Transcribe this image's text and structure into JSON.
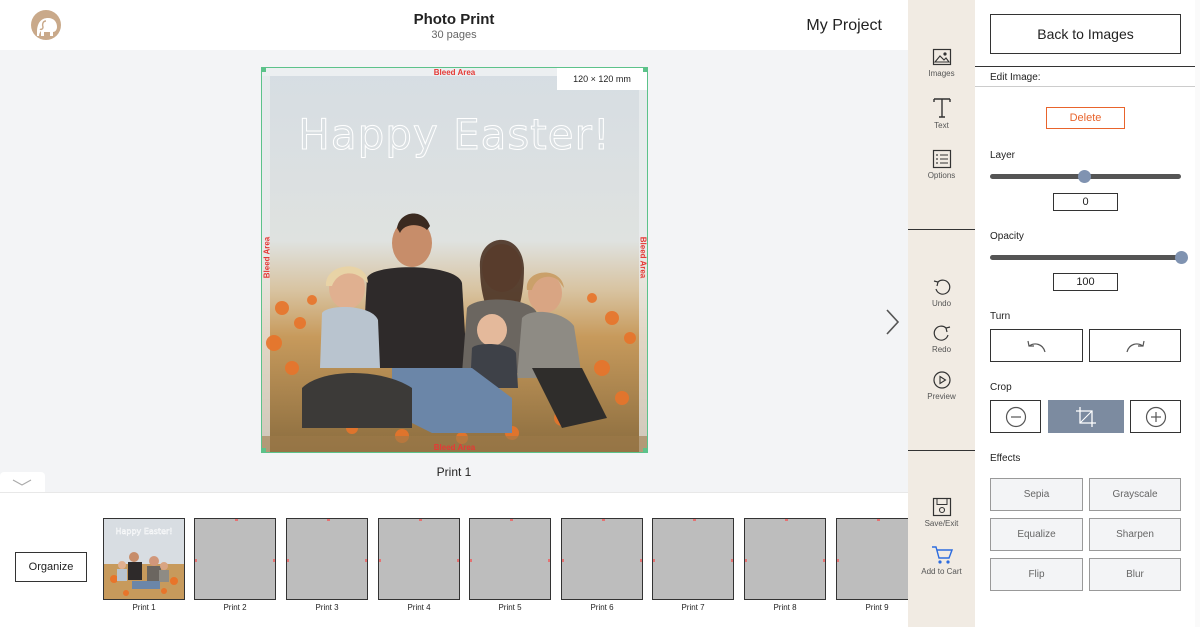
{
  "header": {
    "title": "Photo Print",
    "subtitle": "30 pages",
    "project_name": "My Project"
  },
  "canvas": {
    "bleed_label": "Bleed Area",
    "size_badge": "120 × 120 mm",
    "greeting_text": "Happy Easter!",
    "caption": "Print 1"
  },
  "filmstrip": {
    "organize_label": "Organize",
    "thumbnails": [
      "Print 1",
      "Print 2",
      "Print 3",
      "Print 4",
      "Print 5",
      "Print 6",
      "Print 7",
      "Print 8",
      "Print 9"
    ]
  },
  "tools": {
    "images": "Images",
    "text": "Text",
    "options": "Options",
    "undo": "Undo",
    "redo": "Redo",
    "preview": "Preview",
    "save_exit": "Save/Exit",
    "add_to_cart": "Add to Cart"
  },
  "panel": {
    "back_label": "Back to Images",
    "edit_image_label": "Edit Image:",
    "delete_label": "Delete",
    "layer_label": "Layer",
    "layer_value": "0",
    "layer_fraction": 0.49,
    "opacity_label": "Opacity",
    "opacity_value": "100",
    "opacity_fraction": 1.0,
    "turn_label": "Turn",
    "crop_label": "Crop",
    "effects_label": "Effects",
    "effects": [
      "Sepia",
      "Grayscale",
      "Equalize",
      "Sharpen",
      "Flip",
      "Blur"
    ]
  },
  "colors": {
    "accent_delete": "#e8642c",
    "bleed_red": "#e53935",
    "frame_green": "#5cc28a",
    "slider_thumb": "#8093b1",
    "rail_bg": "#f1ebe3"
  }
}
